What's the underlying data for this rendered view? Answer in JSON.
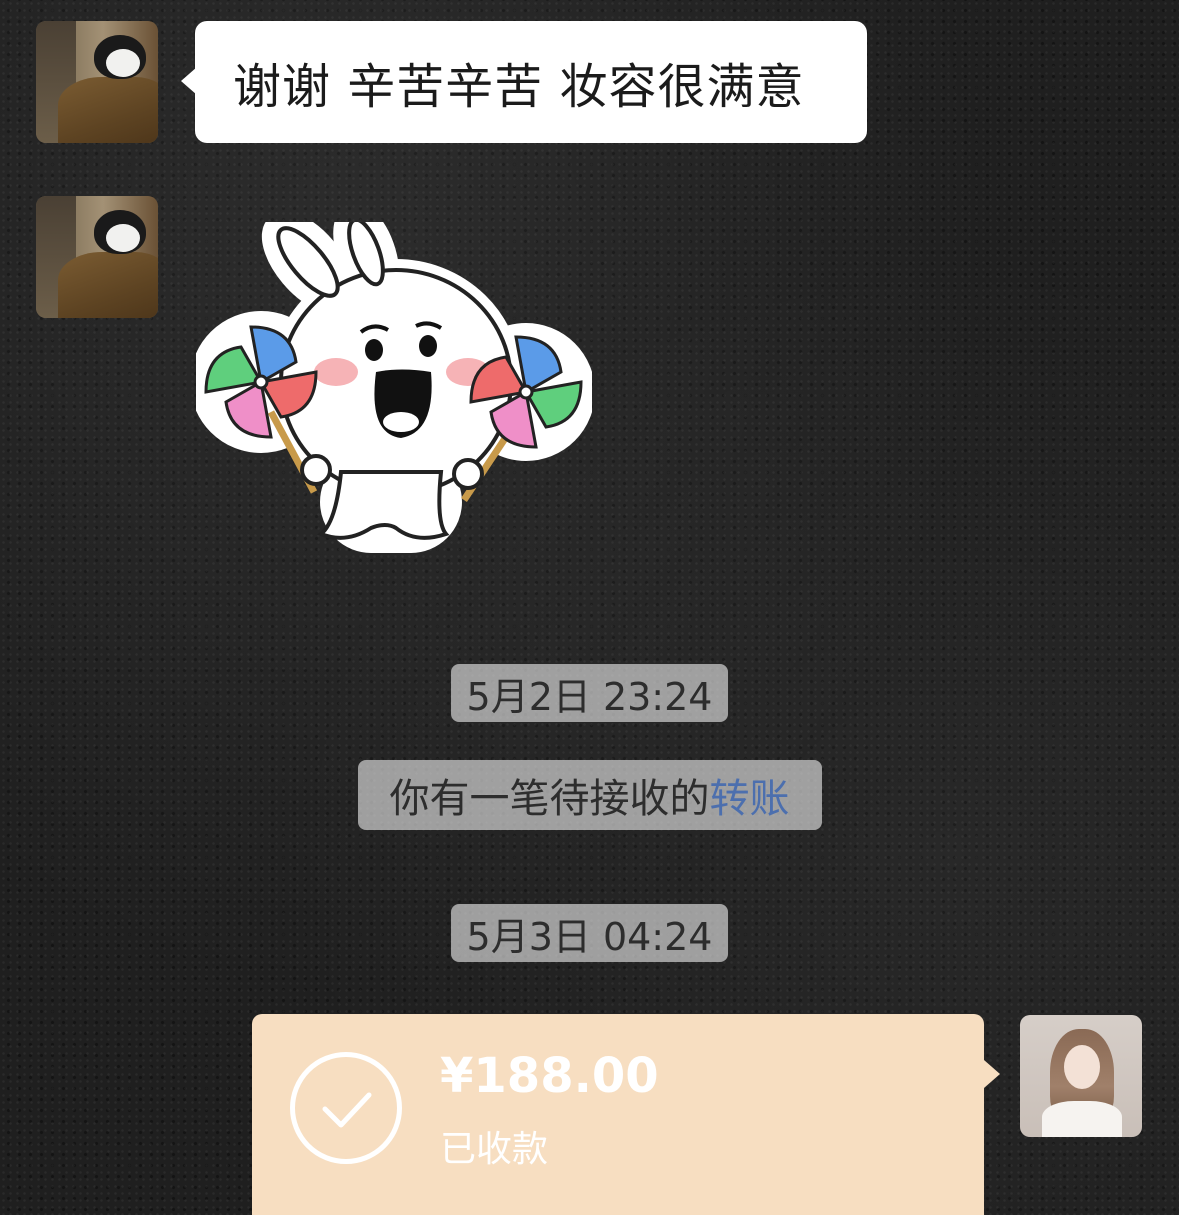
{
  "chat": {
    "messages": [
      {
        "type": "text",
        "direction": "incoming",
        "text": "谢谢 辛苦辛苦 妆容很满意"
      },
      {
        "type": "sticker",
        "direction": "incoming",
        "sticker": "rabbit-with-pinwheels"
      }
    ],
    "timestamps": [
      "5月2日 23:24",
      "5月3日 04:24"
    ],
    "system_notice": {
      "text": "你有一笔待接收的",
      "link": "转账"
    },
    "transfer": {
      "amount": "¥188.00",
      "status": "已收款",
      "status_icon": "checkmark-icon"
    }
  },
  "colors": {
    "transfer_bg": "#f7dec1",
    "link": "#4c6fae",
    "bubble": "#ffffff"
  }
}
